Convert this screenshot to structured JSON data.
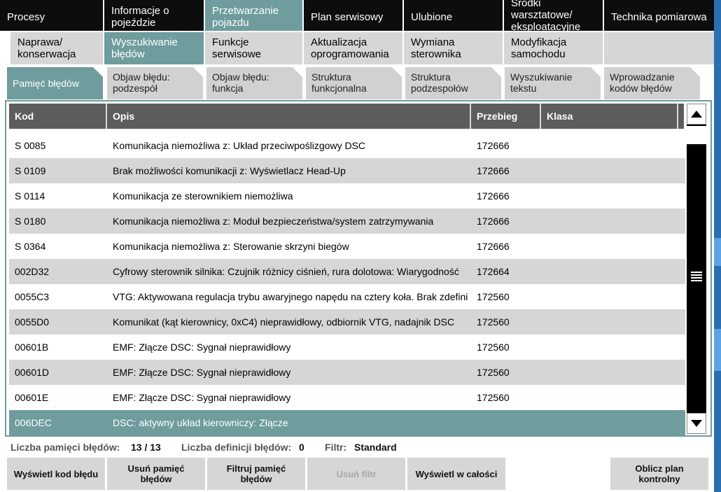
{
  "top_menu": [
    {
      "label": "Procesy"
    },
    {
      "label": "Informacje o pojeździe"
    },
    {
      "label": "Przetwarzanie pojazdu"
    },
    {
      "label": "Plan serwisowy"
    },
    {
      "label": "Ulubione"
    },
    {
      "label": "Środki warsztatowe/ eksploatacyjne"
    },
    {
      "label": "Technika pomiarowa"
    }
  ],
  "sub_menu": [
    {
      "label": "Naprawa/ konserwacja"
    },
    {
      "label": "Wyszukiwanie błędów"
    },
    {
      "label": "Funkcje serwisowe"
    },
    {
      "label": "Aktualizacja oprogramowania"
    },
    {
      "label": "Wymiana sterownika"
    },
    {
      "label": "Modyfikacja samochodu"
    },
    {
      "label": ""
    }
  ],
  "tabs": [
    {
      "label": "Pamięć błędów"
    },
    {
      "label": "Objaw błędu: podzespół"
    },
    {
      "label": "Objaw błędu: funkcja"
    },
    {
      "label": "Struktura funkcjonalna"
    },
    {
      "label": "Struktura podzespołów"
    },
    {
      "label": "Wyszukiwanie tekstu"
    },
    {
      "label": "Wprowadzanie kodów błędów"
    }
  ],
  "table": {
    "columns": [
      "Kod",
      "Opis",
      "Przebieg",
      "Klasa"
    ],
    "rows": [
      {
        "kod": "S 0085",
        "opis": "Komunikacja niemożliwa z: Układ przeciwpoślizgowy DSC",
        "przebieg": "172666",
        "klasa": ""
      },
      {
        "kod": "S 0109",
        "opis": "Brak możliwości komunikacji z: Wyświetlacz Head-Up",
        "przebieg": "172666",
        "klasa": ""
      },
      {
        "kod": "S 0114",
        "opis": "Komunikacja ze sterownikiem niemożliwa",
        "przebieg": "172666",
        "klasa": ""
      },
      {
        "kod": "S 0180",
        "opis": "Komunikacja niemożliwa z: Moduł bezpieczeństwa/system zatrzymywania",
        "przebieg": "172666",
        "klasa": ""
      },
      {
        "kod": "S 0364",
        "opis": "Komunikacja niemożliwa z: Sterowanie skrzyni biegów",
        "przebieg": "172666",
        "klasa": ""
      },
      {
        "kod": "002D32",
        "opis": "Cyfrowy sterownik silnika: Czujnik różnicy ciśnień, rura dolotowa: Wiarygodność",
        "przebieg": "172664",
        "klasa": ""
      },
      {
        "kod": "0055C3",
        "opis": "VTG: Aktywowana regulacja trybu awaryjnego napędu na cztery koła. Brak zdefini",
        "przebieg": "172560",
        "klasa": ""
      },
      {
        "kod": "0055D0",
        "opis": "Komunikat (kąt kierownicy, 0xC4) nieprawidłowy, odbiornik VTG, nadajnik DSC",
        "przebieg": "172560",
        "klasa": ""
      },
      {
        "kod": "00601B",
        "opis": "EMF: Złącze DSC: Sygnał nieprawidłowy",
        "przebieg": "172560",
        "klasa": ""
      },
      {
        "kod": "00601D",
        "opis": "EMF: Złącze DSC: Sygnał nieprawidłowy",
        "przebieg": "172560",
        "klasa": ""
      },
      {
        "kod": "00601E",
        "opis": "EMF: Złącze DSC: Sygnał nieprawidłowy",
        "przebieg": "172560",
        "klasa": ""
      },
      {
        "kod": "006DEC",
        "opis": "DSC: aktywny układ kierowniczy: Złącze",
        "przebieg": "",
        "klasa": ""
      }
    ]
  },
  "status": {
    "memory_label": "Liczba pamięci błędów:",
    "memory_value": "13 / 13",
    "definitions_label": "Liczba definicji błędów:",
    "definitions_value": "0",
    "filter_label": "Filtr:",
    "filter_value": "Standard"
  },
  "buttons": [
    {
      "label": "Wyświetl kod błędu"
    },
    {
      "label": "Usuń pamięć błędów"
    },
    {
      "label": "Filtruj pamięć błędów"
    },
    {
      "label": "Usuń filtr"
    },
    {
      "label": "Wyświetl w całości"
    },
    {
      "label": ""
    },
    {
      "label": "Oblicz plan kontrolny"
    }
  ],
  "colors": {
    "accent": "#6f9c9c",
    "menu_bg": "#0d0d0d",
    "inactive_tab": "#d6d6d6",
    "header_bg": "#5d5d5d"
  }
}
